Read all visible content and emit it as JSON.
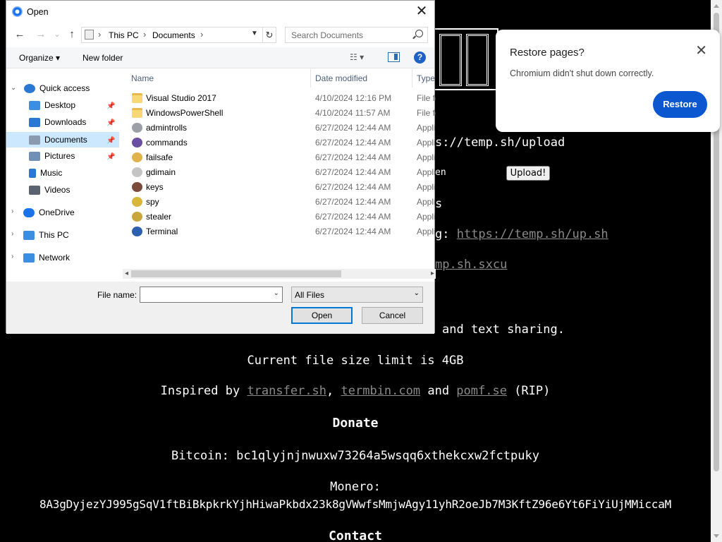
{
  "page": {
    "upload_url_fragment": "s://temp.sh/upload",
    "upload_field_fragment": "en",
    "upload_button": "Upload!",
    "line3_fragment": "s",
    "curl_prefix": "g: ",
    "curl_link": "https://temp.sh/up.sh",
    "sxcu_link": "mp.sh.sxcu",
    "sharing_fragment": "and text sharing.",
    "size_limit": "Current file size limit is 4GB",
    "inspired_prefix": "Inspired by ",
    "inspired_links": [
      "transfer.sh",
      "termbin.com",
      "pomf.se"
    ],
    "inspired_sep1": ", ",
    "inspired_sep2": " and ",
    "inspired_suffix": " (RIP)",
    "donate_heading": "Donate",
    "bitcoin": "Bitcoin: bc1qlyjnjnwuxw73264a5wsqq6xthekcxw2fctpuky",
    "monero_label": "Monero:",
    "monero_address": "8A3gDyjezYJ995gSqV1ftBiBkpkrkYjhHiwaPkbdx23k8gVWwfsMmjwAgy11yhR2oeJb7M3KftZ96e6Yt6FiYiUjMMiccaM",
    "contact_heading": "Contact"
  },
  "restore_popup": {
    "title": "Restore pages?",
    "message": "Chromium didn't shut down correctly.",
    "close_glyph": "✕",
    "button": "Restore"
  },
  "dialog": {
    "title": "Open",
    "close_glyph": "✕",
    "nav": {
      "back": "←",
      "forward": "→",
      "recent": "⌄",
      "up": "↑"
    },
    "address": {
      "crumbs": [
        "This PC",
        "Documents"
      ],
      "sep": "›"
    },
    "search_placeholder": "Search Documents",
    "toolbar": {
      "organize": "Organize ▾",
      "new_folder": "New folder",
      "views_glyph": "☷ ▾",
      "help": "?"
    },
    "sidebar": [
      {
        "label": "Quick access",
        "icon": "star-icon",
        "color": "#2b78d4"
      },
      {
        "label": "Desktop",
        "icon": "desktop-icon",
        "color": "#3c8fe0"
      },
      {
        "label": "Downloads",
        "icon": "download-icon",
        "color": "#2b78d4"
      },
      {
        "label": "Documents",
        "icon": "document-icon",
        "color": "#8a9bb0"
      },
      {
        "label": "Pictures",
        "icon": "picture-icon",
        "color": "#6f8fb5"
      },
      {
        "label": "Music",
        "icon": "music-icon",
        "color": "#2b78d4"
      },
      {
        "label": "Videos",
        "icon": "video-icon",
        "color": "#5a6470"
      },
      {
        "label": "OneDrive",
        "icon": "cloud-icon",
        "color": "#1a73e8"
      },
      {
        "label": "This PC",
        "icon": "computer-icon",
        "color": "#3c8fe0"
      },
      {
        "label": "Network",
        "icon": "network-icon",
        "color": "#3c8fe0"
      }
    ],
    "columns": {
      "name": "Name",
      "date": "Date modified",
      "type": "Type"
    },
    "files": [
      {
        "name": "Visual Studio 2017",
        "date": "4/10/2024 12:16 PM",
        "type": "File fo",
        "kind": "folder"
      },
      {
        "name": "WindowsPowerShell",
        "date": "4/10/2024 11:57 AM",
        "type": "File fo",
        "kind": "folder"
      },
      {
        "name": "admintrolls",
        "date": "6/27/2024 12:44 AM",
        "type": "Applic",
        "kind": "app"
      },
      {
        "name": "commands",
        "date": "6/27/2024 12:44 AM",
        "type": "Applic",
        "kind": "app"
      },
      {
        "name": "failsafe",
        "date": "6/27/2024 12:44 AM",
        "type": "Applic",
        "kind": "app"
      },
      {
        "name": "gdimain",
        "date": "6/27/2024 12:44 AM",
        "type": "Applic",
        "kind": "app"
      },
      {
        "name": "keys",
        "date": "6/27/2024 12:44 AM",
        "type": "Applic",
        "kind": "app"
      },
      {
        "name": "spy",
        "date": "6/27/2024 12:44 AM",
        "type": "Applic",
        "kind": "app"
      },
      {
        "name": "stealer",
        "date": "6/27/2024 12:44 AM",
        "type": "Applic",
        "kind": "app"
      },
      {
        "name": "Terminal",
        "date": "6/27/2024 12:44 AM",
        "type": "Applic",
        "kind": "app"
      }
    ],
    "file_name_label": "File name:",
    "file_name_value": "",
    "file_type": "All Files",
    "open_button": "Open",
    "cancel_button": "Cancel"
  }
}
